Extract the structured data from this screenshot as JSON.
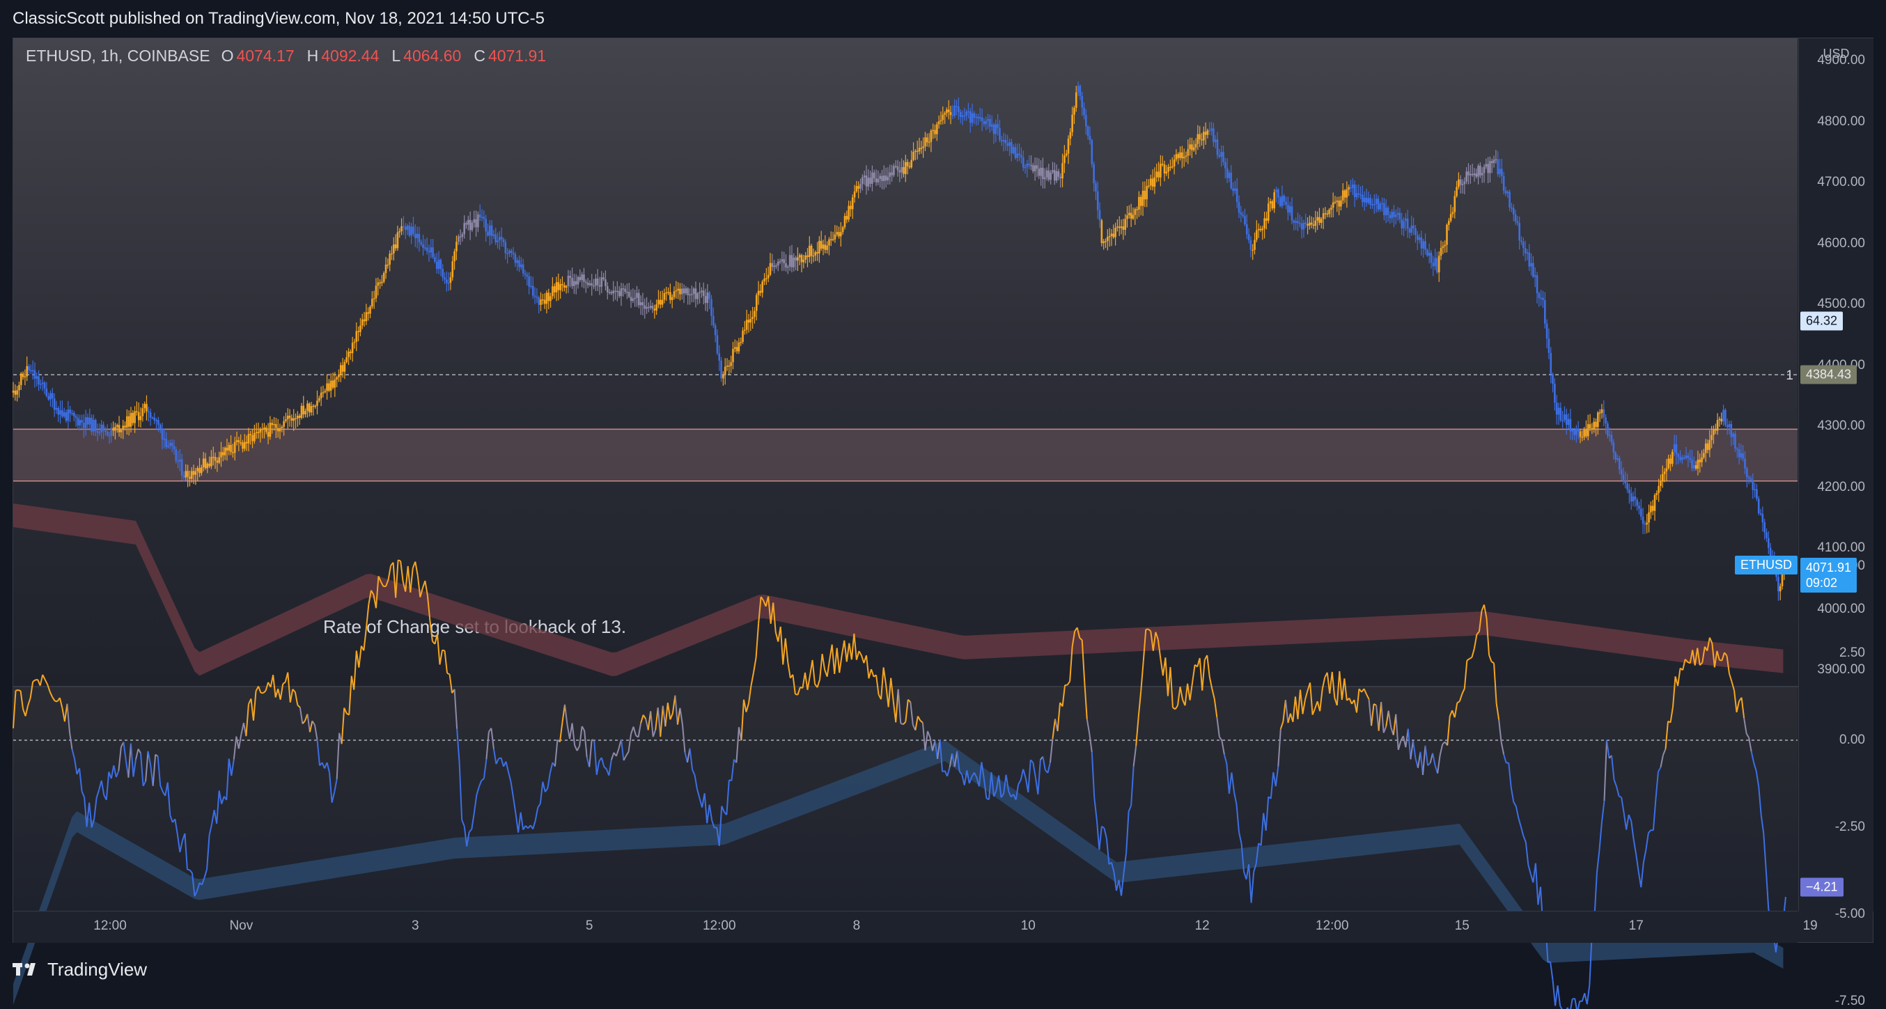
{
  "header": {
    "publisher_text": "ClassicScott published on TradingView.com, Nov 18, 2021 14:50 UTC-5"
  },
  "legend": {
    "symbol": "ETHUSD, 1h, COINBASE",
    "open_label": "O",
    "open": "4074.17",
    "high_label": "H",
    "high": "4092.44",
    "low_label": "L",
    "low": "4064.60",
    "close_label": "C",
    "close": "4071.91"
  },
  "annotation": "Rate of Change set to lookback of 13.",
  "price_axis": {
    "currency": "USD",
    "ticks": [
      "4900.00",
      "4800.00",
      "4700.00",
      "4600.00",
      "4500.00",
      "4400.00",
      "4300.00",
      "4200.00",
      "4100.00",
      "4000.00",
      "3900.00"
    ],
    "badges": {
      "roc_value_main": "64.32",
      "line_price": "4384.43",
      "line_label": "1",
      "symbol_tag": "ETHUSD",
      "last_price": "4071.91",
      "countdown": "09:02"
    }
  },
  "roc_axis": {
    "ticks": [
      "5.00",
      "2.50",
      "0.00",
      "-2.50",
      "-5.00",
      "-7.50"
    ],
    "current_value": "−4.21"
  },
  "time_axis": {
    "ticks": [
      "12:00",
      "Nov",
      "3",
      "5",
      "12:00",
      "8",
      "10",
      "12",
      "12:00",
      "15",
      "17",
      "19"
    ]
  },
  "footer": {
    "brand": "TradingView"
  },
  "colors": {
    "bullish": "#f5a623",
    "bearish": "#3d6fe3",
    "neutral": "#8f8aa8",
    "zone_fill": "#5a4a52",
    "zone_border": "#c98b8b",
    "band_upper": "#6e3b44",
    "band_lower": "#2c4a6e",
    "last_price_badge": "#2f9ff3",
    "roc_badge": "#6f75d8"
  },
  "chart_data": [
    {
      "type": "candlestick",
      "title": "ETHUSD, 1h, COINBASE",
      "x_ticks": [
        "12:00",
        "Nov",
        "3",
        "5",
        "12:00",
        "8",
        "10",
        "12",
        "12:00",
        "15",
        "17",
        "19"
      ],
      "ylim": [
        3860,
        4960
      ],
      "horizontal_line": 4384.43,
      "zone": [
        4210,
        4295
      ],
      "path_anchors": [
        {
          "x": 0,
          "close": 4355
        },
        {
          "x": 12,
          "close": 4395
        },
        {
          "x": 40,
          "close": 4320
        },
        {
          "x": 80,
          "close": 4290
        },
        {
          "x": 110,
          "close": 4330
        },
        {
          "x": 140,
          "close": 4220
        },
        {
          "x": 175,
          "close": 4260
        },
        {
          "x": 210,
          "close": 4295
        },
        {
          "x": 240,
          "close": 4330
        },
        {
          "x": 265,
          "close": 4380
        },
        {
          "x": 285,
          "close": 4470
        },
        {
          "x": 318,
          "close": 4630
        },
        {
          "x": 340,
          "close": 4590
        },
        {
          "x": 356,
          "close": 4530
        },
        {
          "x": 362,
          "close": 4615
        },
        {
          "x": 380,
          "close": 4640
        },
        {
          "x": 410,
          "close": 4570
        },
        {
          "x": 430,
          "close": 4505
        },
        {
          "x": 452,
          "close": 4540
        },
        {
          "x": 480,
          "close": 4535
        },
        {
          "x": 503,
          "close": 4512
        },
        {
          "x": 523,
          "close": 4498
        },
        {
          "x": 545,
          "close": 4525
        },
        {
          "x": 568,
          "close": 4510
        },
        {
          "x": 578,
          "close": 4380
        },
        {
          "x": 597,
          "close": 4460
        },
        {
          "x": 618,
          "close": 4560
        },
        {
          "x": 640,
          "close": 4575
        },
        {
          "x": 672,
          "close": 4610
        },
        {
          "x": 690,
          "close": 4700
        },
        {
          "x": 725,
          "close": 4720
        },
        {
          "x": 765,
          "close": 4820
        },
        {
          "x": 800,
          "close": 4790
        },
        {
          "x": 830,
          "close": 4720
        },
        {
          "x": 855,
          "close": 4710
        },
        {
          "x": 868,
          "close": 4855
        },
        {
          "x": 878,
          "close": 4770
        },
        {
          "x": 888,
          "close": 4600
        },
        {
          "x": 910,
          "close": 4640
        },
        {
          "x": 935,
          "close": 4720
        },
        {
          "x": 958,
          "close": 4750
        },
        {
          "x": 975,
          "close": 4790
        },
        {
          "x": 992,
          "close": 4710
        },
        {
          "x": 1010,
          "close": 4595
        },
        {
          "x": 1030,
          "close": 4680
        },
        {
          "x": 1055,
          "close": 4620
        },
        {
          "x": 1075,
          "close": 4655
        },
        {
          "x": 1090,
          "close": 4690
        },
        {
          "x": 1115,
          "close": 4660
        },
        {
          "x": 1140,
          "close": 4625
        },
        {
          "x": 1162,
          "close": 4560
        },
        {
          "x": 1180,
          "close": 4705
        },
        {
          "x": 1210,
          "close": 4730
        },
        {
          "x": 1228,
          "close": 4620
        },
        {
          "x": 1248,
          "close": 4500
        },
        {
          "x": 1258,
          "close": 4330
        },
        {
          "x": 1278,
          "close": 4280
        },
        {
          "x": 1296,
          "close": 4320
        },
        {
          "x": 1318,
          "close": 4190
        },
        {
          "x": 1332,
          "close": 4140
        },
        {
          "x": 1355,
          "close": 4260
        },
        {
          "x": 1372,
          "close": 4230
        },
        {
          "x": 1395,
          "close": 4320
        },
        {
          "x": 1412,
          "close": 4240
        },
        {
          "x": 1425,
          "close": 4160
        },
        {
          "x": 1432,
          "close": 4110
        },
        {
          "x": 1440,
          "close": 4030
        },
        {
          "x": 1446,
          "close": 4071.91
        }
      ]
    },
    {
      "type": "line",
      "title": "Rate of Change",
      "lookback": 13,
      "ylim": [
        -9.5,
        7.5
      ],
      "y_ticks": [
        5.0,
        2.5,
        0.0,
        -2.5,
        -5.0,
        -7.5
      ],
      "last_value": -4.21,
      "anchors": [
        {
          "x": 0,
          "y": 0.8
        },
        {
          "x": 25,
          "y": 1.8
        },
        {
          "x": 45,
          "y": 0.5
        },
        {
          "x": 60,
          "y": -2.3
        },
        {
          "x": 90,
          "y": -0.5
        },
        {
          "x": 120,
          "y": -1.0
        },
        {
          "x": 150,
          "y": -4.2
        },
        {
          "x": 180,
          "y": -0.5
        },
        {
          "x": 200,
          "y": 1.5
        },
        {
          "x": 230,
          "y": 1.5
        },
        {
          "x": 260,
          "y": -1.3
        },
        {
          "x": 290,
          "y": 3.8
        },
        {
          "x": 300,
          "y": 4.5
        },
        {
          "x": 330,
          "y": 4.8
        },
        {
          "x": 360,
          "y": 1.2
        },
        {
          "x": 368,
          "y": -3.0
        },
        {
          "x": 390,
          "y": 0.3
        },
        {
          "x": 420,
          "y": -3.0
        },
        {
          "x": 450,
          "y": 0.5
        },
        {
          "x": 480,
          "y": -0.8
        },
        {
          "x": 510,
          "y": 0.2
        },
        {
          "x": 540,
          "y": 0.8
        },
        {
          "x": 575,
          "y": -2.8
        },
        {
          "x": 600,
          "y": 1.5
        },
        {
          "x": 612,
          "y": 4.3
        },
        {
          "x": 640,
          "y": 1.5
        },
        {
          "x": 690,
          "y": 2.8
        },
        {
          "x": 720,
          "y": 1.0
        },
        {
          "x": 760,
          "y": -0.5
        },
        {
          "x": 800,
          "y": -1.3
        },
        {
          "x": 840,
          "y": -1.0
        },
        {
          "x": 870,
          "y": 3.4
        },
        {
          "x": 885,
          "y": -2.6
        },
        {
          "x": 905,
          "y": -4.3
        },
        {
          "x": 925,
          "y": 3.5
        },
        {
          "x": 950,
          "y": 1.0
        },
        {
          "x": 975,
          "y": 2.2
        },
        {
          "x": 1010,
          "y": -4.4
        },
        {
          "x": 1040,
          "y": 1.0
        },
        {
          "x": 1080,
          "y": 1.5
        },
        {
          "x": 1130,
          "y": 0.2
        },
        {
          "x": 1160,
          "y": -0.8
        },
        {
          "x": 1200,
          "y": 3.5
        },
        {
          "x": 1220,
          "y": -1.0
        },
        {
          "x": 1245,
          "y": -4.5
        },
        {
          "x": 1260,
          "y": -7.5
        },
        {
          "x": 1285,
          "y": -7.2
        },
        {
          "x": 1300,
          "y": -0.5
        },
        {
          "x": 1330,
          "y": -4.0
        },
        {
          "x": 1360,
          "y": 2.5
        },
        {
          "x": 1395,
          "y": 2.5
        },
        {
          "x": 1420,
          "y": -0.5
        },
        {
          "x": 1438,
          "y": -6.3
        },
        {
          "x": 1446,
          "y": -4.21
        }
      ],
      "upper_band": [
        {
          "x": 0,
          "y": 6.8
        },
        {
          "x": 100,
          "y": 6.3
        },
        {
          "x": 150,
          "y": 2.5
        },
        {
          "x": 290,
          "y": 4.8
        },
        {
          "x": 490,
          "y": 2.5
        },
        {
          "x": 610,
          "y": 4.2
        },
        {
          "x": 775,
          "y": 3.0
        },
        {
          "x": 1200,
          "y": 3.7
        },
        {
          "x": 1365,
          "y": 2.9
        },
        {
          "x": 1446,
          "y": 2.6
        }
      ],
      "lower_band": [
        {
          "x": 0,
          "y": -7.0
        },
        {
          "x": 50,
          "y": -2.0
        },
        {
          "x": 150,
          "y": -4.0
        },
        {
          "x": 360,
          "y": -2.8
        },
        {
          "x": 580,
          "y": -2.4
        },
        {
          "x": 760,
          "y": 0.0
        },
        {
          "x": 900,
          "y": -3.5
        },
        {
          "x": 1180,
          "y": -2.4
        },
        {
          "x": 1250,
          "y": -5.8
        },
        {
          "x": 1420,
          "y": -5.5
        },
        {
          "x": 1446,
          "y": -6.0
        }
      ]
    }
  ]
}
